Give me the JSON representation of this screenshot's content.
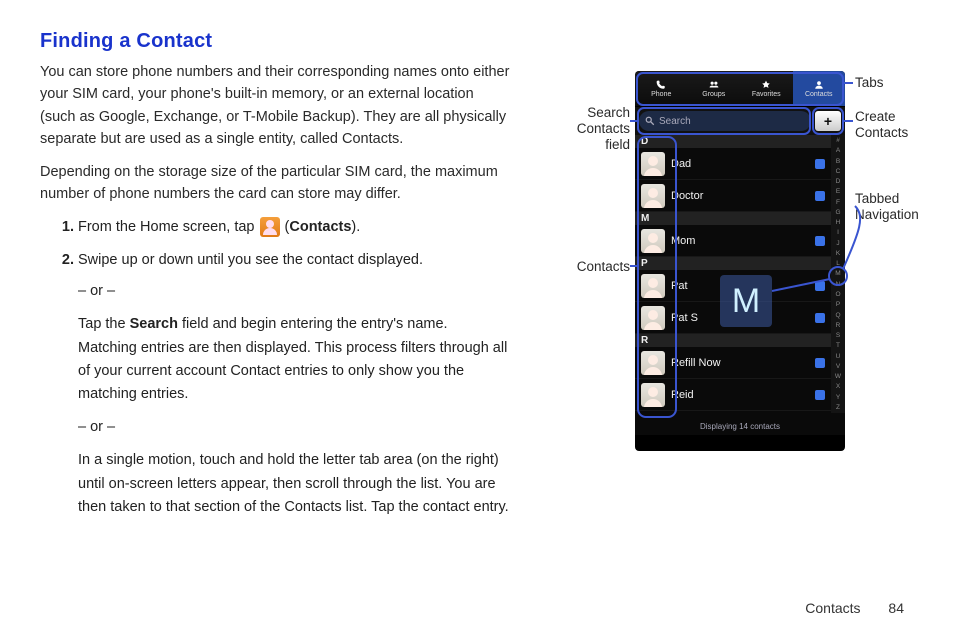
{
  "title": "Finding a Contact",
  "paragraphs": {
    "p1": "You can store phone numbers and their corresponding names onto either your SIM card, your phone's built-in memory, or an external location (such as Google, Exchange, or T-Mobile Backup). They are all physically separate but are used as a single entity, called Contacts.",
    "p2": "Depending on the storage size of the particular SIM card, the maximum number of phone numbers the card can store may differ."
  },
  "steps": {
    "s1_prefix": "From the Home screen, tap ",
    "s1_suffix_open": " (",
    "s1_bold": "Contacts",
    "s1_suffix_close": ").",
    "s2": "Swipe up or down until you see the contact displayed.",
    "or": "– or –",
    "s2b_pre": "Tap the ",
    "s2b_bold": "Search",
    "s2b_post": " field and begin entering the entry's name. Matching entries are then displayed. This process filters through all of your current account Contact entries to only show you the matching entries.",
    "s2c": "In a single motion, touch and hold the letter tab area (on the right) until on-screen letters appear, then scroll through the list. You are then taken to that section of the Contacts list. Tap the contact entry."
  },
  "callouts": {
    "tabs": "Tabs",
    "search": "Search Contacts field",
    "create": "Create Contacts",
    "contacts": "Contacts",
    "tabbed_nav": "Tabbed Navigation"
  },
  "phone": {
    "tabs": {
      "phone": "Phone",
      "groups": "Groups",
      "favorites": "Favorites",
      "contacts": "Contacts"
    },
    "search_placeholder": "Search",
    "add_label": "+",
    "sections": {
      "d": "D",
      "m": "M",
      "p": "P",
      "r": "R"
    },
    "contacts": {
      "c0": "Dad",
      "c1": "Doctor",
      "c2": "Mom",
      "c3": "Pat",
      "c4": "Pat S",
      "c5": "Refill Now",
      "c6": "Reid"
    },
    "popup_letter": "M",
    "index_letters": [
      "#",
      "A",
      "B",
      "C",
      "D",
      "E",
      "F",
      "G",
      "H",
      "I",
      "J",
      "K",
      "L",
      "M",
      "N",
      "O",
      "P",
      "Q",
      "R",
      "S",
      "T",
      "U",
      "V",
      "W",
      "X",
      "Y",
      "Z"
    ],
    "footer": "Displaying 14 contacts"
  },
  "footer": {
    "section": "Contacts",
    "page": "84"
  }
}
